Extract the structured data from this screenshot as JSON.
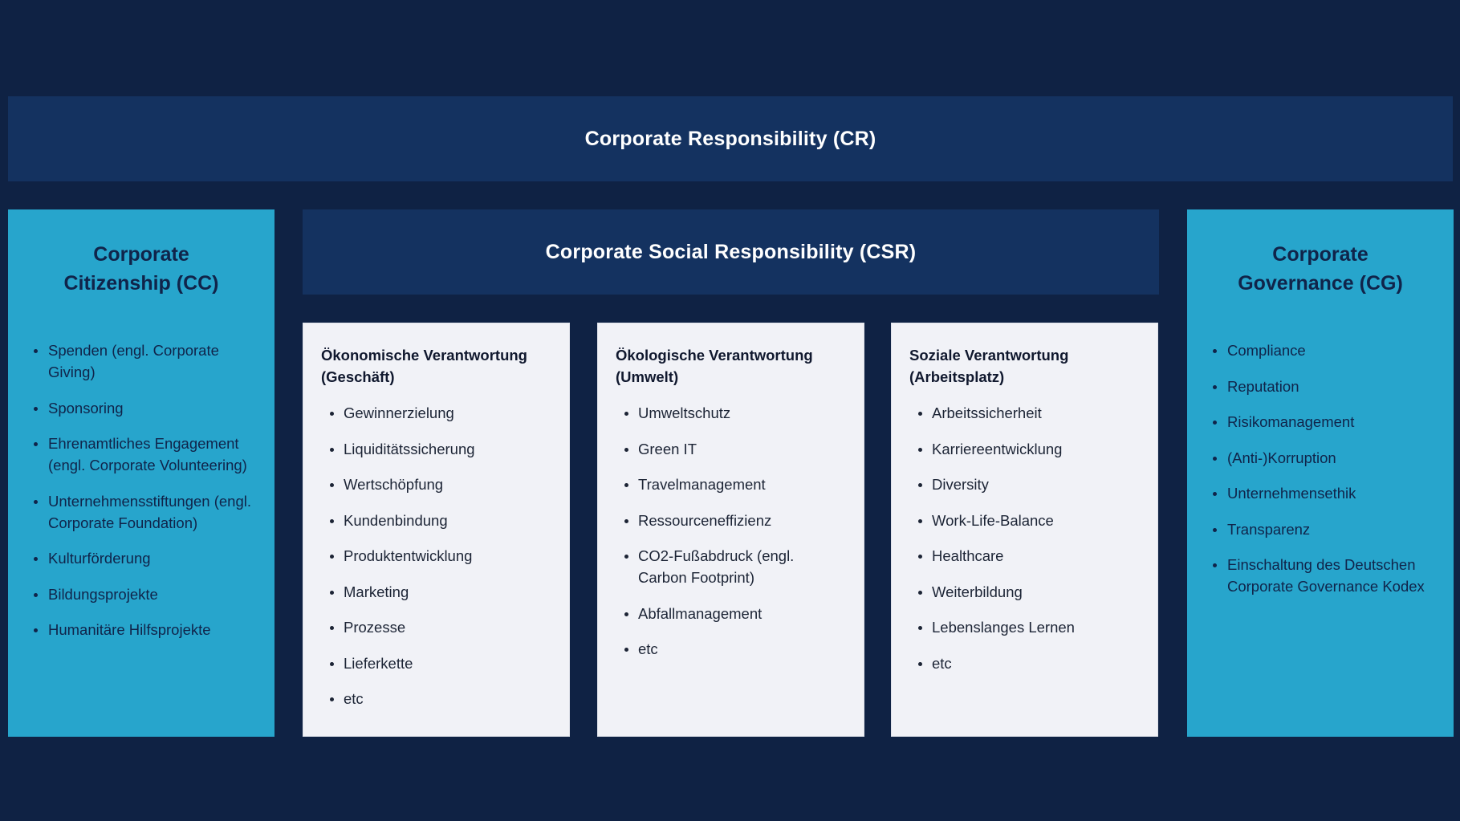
{
  "colors": {
    "background": "#0f2244",
    "header_bar": "#143260",
    "side_column": "#27a5cc",
    "pillar_card": "#f1f2f7",
    "dark_text": "#10244a",
    "light_text": "#ffffff"
  },
  "cr": {
    "title": "Corporate Responsibility (CR)"
  },
  "csr": {
    "title": "Corporate Social Responsibility (CSR)",
    "pillars": [
      {
        "title": "Ökonomische Verantwortung (Geschäft)",
        "items": [
          "Gewinnerzielung",
          "Liquiditätssicherung",
          "Wertschöpfung",
          "Kundenbindung",
          "Produktentwicklung",
          "Marketing",
          "Prozesse",
          "Lieferkette",
          "etc"
        ]
      },
      {
        "title": "Ökologische Verantwortung (Umwelt)",
        "items": [
          "Umweltschutz",
          "Green IT",
          "Travelmanagement",
          "Ressourceneffizienz",
          "CO2-Fußabdruck (engl. Carbon Footprint)",
          "Abfallmanagement",
          "etc"
        ]
      },
      {
        "title": "Soziale Verantwortung (Arbeitsplatz)",
        "items": [
          "Arbeitssicherheit",
          "Karriereentwicklung",
          "Diversity",
          "Work-Life-Balance",
          "Healthcare",
          "Weiterbildung",
          "Lebenslanges Lernen",
          "etc"
        ]
      }
    ]
  },
  "cc": {
    "title_line1": "Corporate",
    "title_line2": "Citizenship (CC)",
    "items": [
      "Spenden (engl. Corporate Giving)",
      "Sponsoring",
      "Ehrenamtliches Engagement (engl. Corporate Volunteering)",
      "Unternehmensstiftungen (engl. Corporate Foundation)",
      "Kulturförderung",
      "Bildungsprojekte",
      "Humanitäre Hilfsprojekte"
    ]
  },
  "cg": {
    "title_line1": "Corporate",
    "title_line2": "Governance (CG)",
    "items": [
      "Compliance",
      "Reputation",
      "Risikomanagement",
      "(Anti-)Korruption",
      "Unternehmensethik",
      "Transparenz",
      "Einschaltung des Deutschen Corporate Governance Kodex"
    ]
  }
}
